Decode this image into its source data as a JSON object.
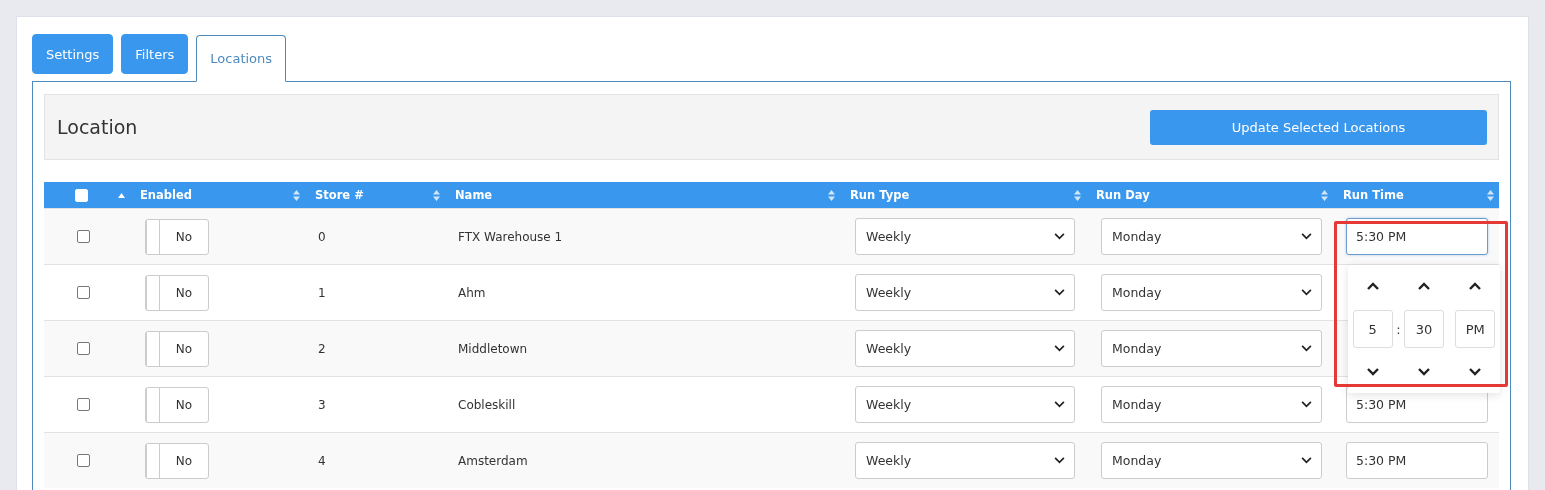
{
  "tabs": [
    {
      "label": "Settings",
      "selected": false
    },
    {
      "label": "Filters",
      "selected": false
    },
    {
      "label": "Locations",
      "selected": true
    }
  ],
  "panel": {
    "title": "Location",
    "button": "Update Selected Locations"
  },
  "table": {
    "select_all_checked": false,
    "columns": [
      {
        "sorted_ascending": true
      },
      {
        "label": "Enabled",
        "sorted_ascending": false
      },
      {
        "label": "Store #",
        "sorted_ascending": false
      },
      {
        "label": "Name",
        "sorted_ascending": false
      },
      {
        "label": "Run Type",
        "sorted_ascending": false
      },
      {
        "label": "Run Day",
        "sorted_ascending": false
      },
      {
        "label": "Run Time",
        "sorted_ascending": false
      }
    ],
    "rows": [
      {
        "checked": false,
        "enabled": false,
        "toggle_label": "No",
        "store": "0",
        "name": "FTX Warehouse 1",
        "run_type": "Weekly",
        "run_day": "Monday",
        "run_time": "5:30 PM",
        "focused": true
      },
      {
        "checked": false,
        "enabled": false,
        "toggle_label": "No",
        "store": "1",
        "name": "Ahm",
        "run_type": "Weekly",
        "run_day": "Monday",
        "focused": false
      },
      {
        "checked": false,
        "enabled": false,
        "toggle_label": "No",
        "store": "2",
        "name": "Middletown",
        "run_type": "Weekly",
        "run_day": "Monday",
        "focused": false
      },
      {
        "checked": false,
        "enabled": false,
        "toggle_label": "No",
        "store": "3",
        "name": "Cobleskill",
        "run_type": "Weekly",
        "run_day": "Monday",
        "run_time": "5:30 PM",
        "focused": false
      },
      {
        "checked": false,
        "enabled": false,
        "toggle_label": "No",
        "store": "4",
        "name": "Amsterdam",
        "run_type": "Weekly",
        "run_day": "Monday",
        "run_time": "5:30 PM",
        "focused": false
      }
    ]
  },
  "time_picker": {
    "hour": "5",
    "separator": ":",
    "minute": "30",
    "period": "PM",
    "highlighted": true
  }
}
